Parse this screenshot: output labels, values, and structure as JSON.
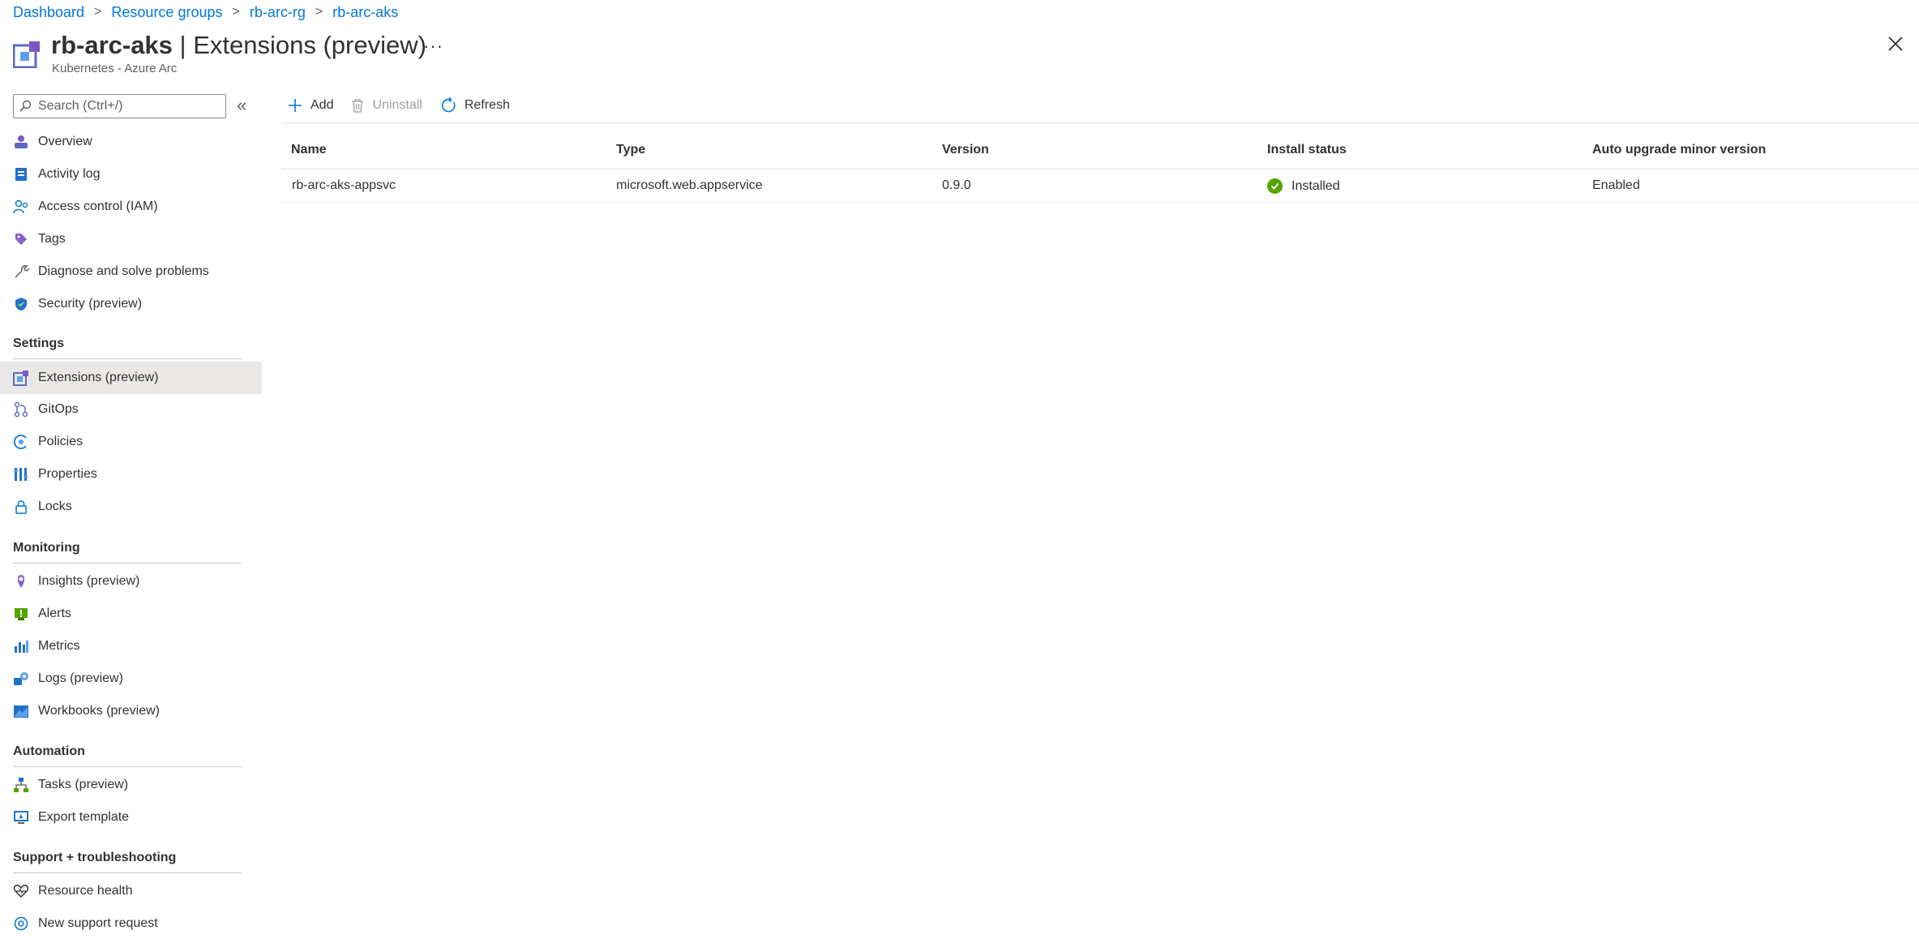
{
  "breadcrumb": [
    "Dashboard",
    "Resource groups",
    "rb-arc-rg",
    "rb-arc-aks"
  ],
  "header": {
    "resource_name": "rb-arc-aks",
    "page_title": " | Extensions (preview)",
    "subtitle": "Kubernetes - Azure Arc",
    "more_label": "···"
  },
  "search": {
    "placeholder": "Search (Ctrl+/)"
  },
  "nav": {
    "items_top": [
      {
        "label": "Overview",
        "icon": "overview-icon"
      },
      {
        "label": "Activity log",
        "icon": "activity-log-icon"
      },
      {
        "label": "Access control (IAM)",
        "icon": "iam-icon"
      },
      {
        "label": "Tags",
        "icon": "tag-icon"
      },
      {
        "label": "Diagnose and solve problems",
        "icon": "wrench-icon"
      },
      {
        "label": "Security (preview)",
        "icon": "shield-icon"
      }
    ],
    "sections": [
      {
        "title": "Settings",
        "items": [
          {
            "label": "Extensions (preview)",
            "icon": "extensions-icon",
            "active": true
          },
          {
            "label": "GitOps",
            "icon": "gitops-icon"
          },
          {
            "label": "Policies",
            "icon": "policy-icon"
          },
          {
            "label": "Properties",
            "icon": "properties-icon"
          },
          {
            "label": "Locks",
            "icon": "lock-icon"
          }
        ]
      },
      {
        "title": "Monitoring",
        "items": [
          {
            "label": "Insights (preview)",
            "icon": "insights-icon"
          },
          {
            "label": "Alerts",
            "icon": "alerts-icon"
          },
          {
            "label": "Metrics",
            "icon": "metrics-icon"
          },
          {
            "label": "Logs (preview)",
            "icon": "logs-icon"
          },
          {
            "label": "Workbooks (preview)",
            "icon": "workbooks-icon"
          }
        ]
      },
      {
        "title": "Automation",
        "items": [
          {
            "label": "Tasks (preview)",
            "icon": "tasks-icon"
          },
          {
            "label": "Export template",
            "icon": "export-template-icon"
          }
        ]
      },
      {
        "title": "Support + troubleshooting",
        "items": [
          {
            "label": "Resource health",
            "icon": "heart-icon"
          },
          {
            "label": "New support request",
            "icon": "support-icon"
          }
        ]
      }
    ]
  },
  "toolbar": {
    "add": "Add",
    "uninstall": "Uninstall",
    "refresh": "Refresh"
  },
  "table": {
    "columns": [
      "Name",
      "Type",
      "Version",
      "Install status",
      "Auto upgrade minor version"
    ],
    "rows": [
      {
        "name": "rb-arc-aks-appsvc",
        "type": "microsoft.web.appservice",
        "version": "0.9.0",
        "status": "Installed",
        "auto_upgrade": "Enabled"
      }
    ]
  },
  "colors": {
    "accent": "#0078d4",
    "success": "#57a300",
    "active_bg": "#e9e8e7"
  }
}
